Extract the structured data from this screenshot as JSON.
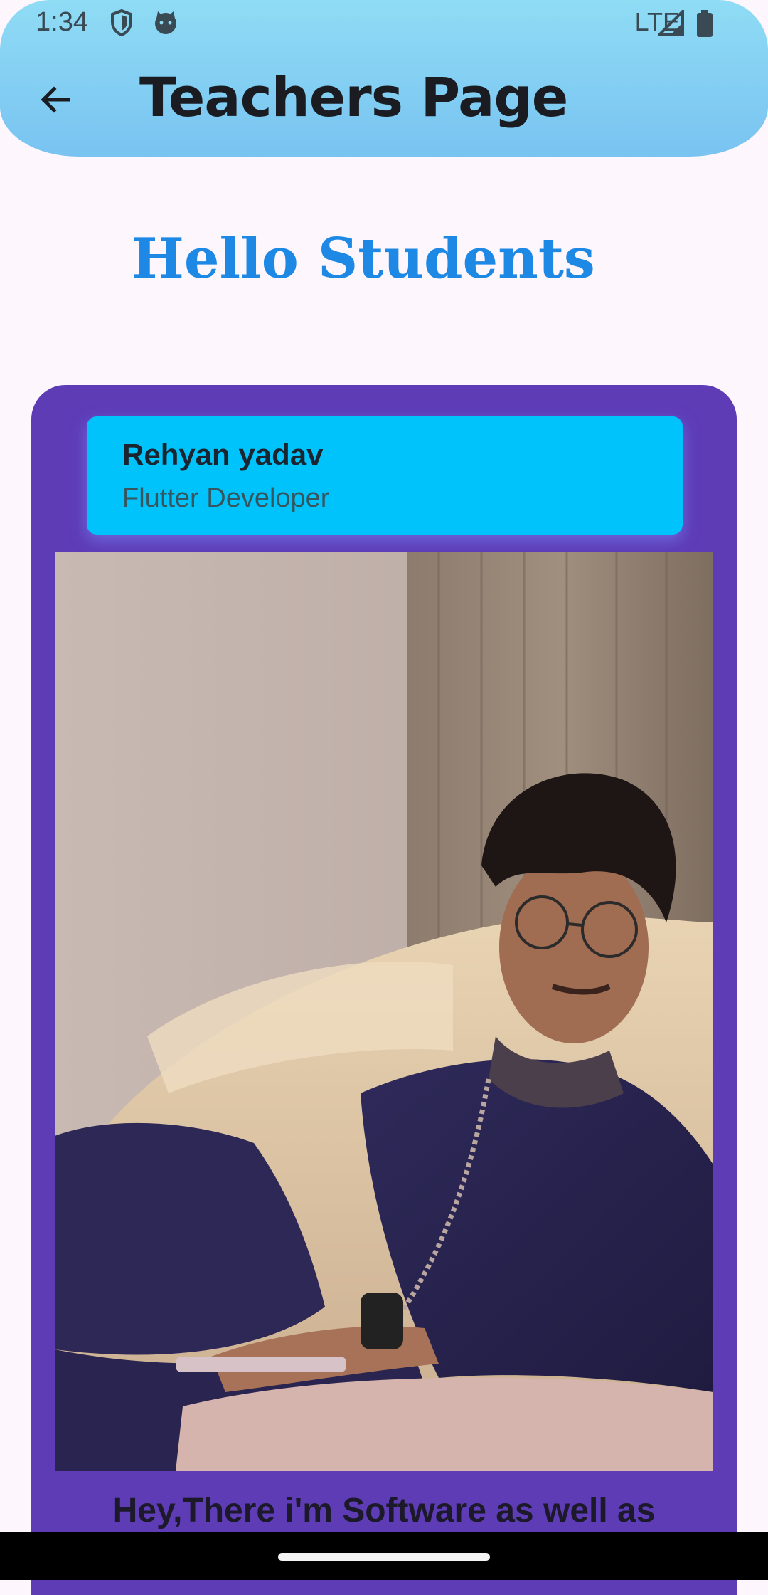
{
  "status_bar": {
    "time": "1:34",
    "network": "LTE"
  },
  "app_bar": {
    "title": "Teachers Page"
  },
  "greeting": "Hello Students",
  "profile": {
    "name": "Rehyan yadav",
    "role": "Flutter Developer",
    "bio": "Hey,There i'm Software as well as"
  },
  "colors": {
    "app_bar": "#8fdcf5",
    "greeting": "#1e88e5",
    "card": "#5e3cb6",
    "name_tile": "#00c3fb",
    "page_background": "#fdf6fd"
  }
}
